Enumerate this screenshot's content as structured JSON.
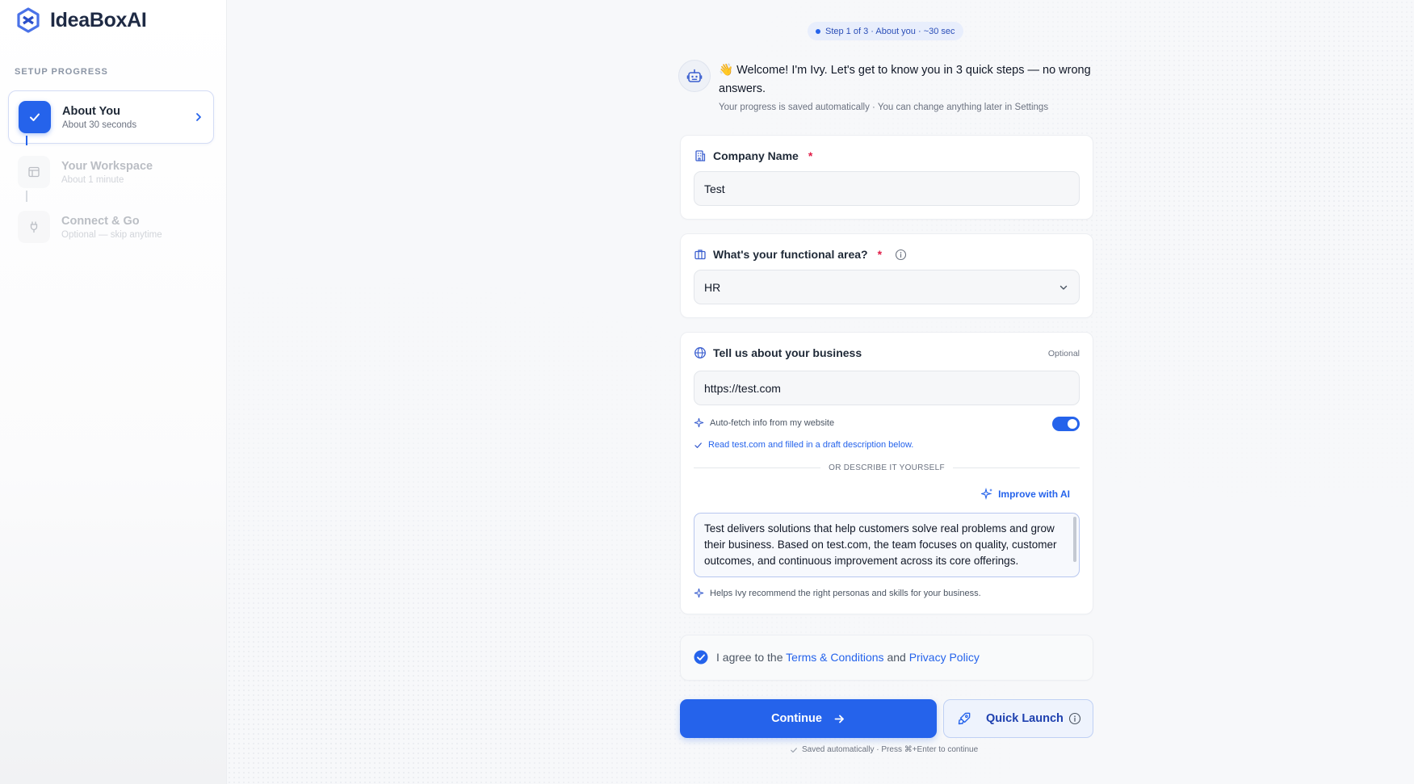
{
  "app": {
    "brand_name": "IdeaBoxAI"
  },
  "sidebar": {
    "section_label": "SETUP PROGRESS",
    "steps": [
      {
        "title": "About You",
        "subtitle": "About 30 seconds",
        "status": "active"
      },
      {
        "title": "Your Workspace",
        "subtitle": "About 1 minute",
        "status": "upcoming"
      },
      {
        "title": "Connect & Go",
        "subtitle": "Optional — skip anytime",
        "status": "upcoming"
      }
    ]
  },
  "header": {
    "step_pill": "Step 1 of 3 · About you · ~30 sec"
  },
  "welcome": {
    "emoji": "👋",
    "message": "Welcome! I'm Ivy. Let's get to know you in 3 quick steps — no wrong answers.",
    "note": "Your progress is saved automatically · You can change anything later in Settings"
  },
  "company": {
    "label": "Company Name",
    "required_mark": "*",
    "value": "Test"
  },
  "functional_area": {
    "label": "What's your functional area?",
    "required_mark": "*",
    "selected": "HR"
  },
  "business": {
    "label": "Tell us about your business",
    "optional_label": "Optional",
    "website_value": "https://test.com",
    "auto_fetch_label": "Auto-fetch info from my website",
    "auto_fetch_on": true,
    "fetch_status": "Read test.com and filled in a draft description below.",
    "divider_text": "OR DESCRIBE IT YOURSELF",
    "improve_label": "Improve with AI",
    "description": "Test delivers solutions that help customers solve real problems and grow their business. Based on test.com, the team focuses on quality, customer outcomes, and continuous improvement across its core offerings.",
    "helper": "Helps Ivy recommend the right personas and skills for your business."
  },
  "agreement": {
    "prefix": "I agree to the",
    "terms_link": "Terms & Conditions",
    "joiner": "and",
    "privacy_link": "Privacy Policy"
  },
  "actions": {
    "continue_label": "Continue",
    "quick_launch_label": "Quick Launch",
    "footer_note": "Saved automatically · Press ⌘+Enter to continue"
  },
  "colors": {
    "accent": "#2563eb",
    "required": "#e11d48"
  }
}
